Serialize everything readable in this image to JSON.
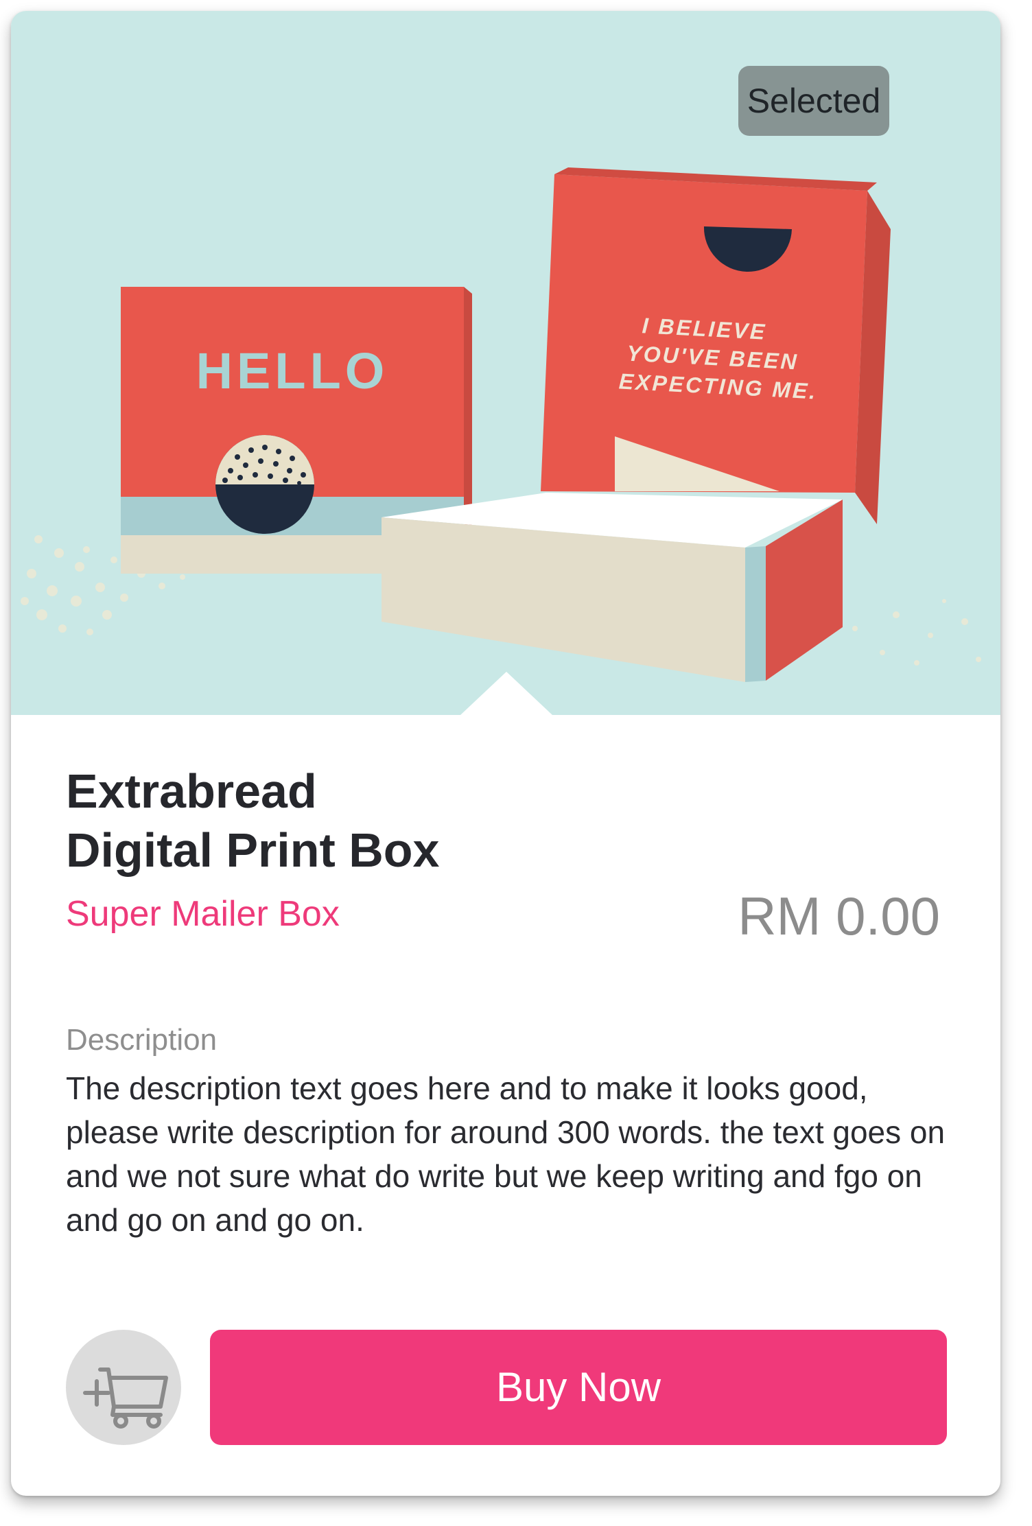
{
  "product": {
    "badge": "Selected",
    "name_line1": "Extrabread",
    "name_line2": "Digital Print Box",
    "category": "Super Mailer Box",
    "price": "RM 0.00"
  },
  "image_text": {
    "closed_box": "HELLO",
    "open_box_line1": "I BELIEVE",
    "open_box_line2": "YOU'VE BEEN",
    "open_box_line3": "EXPECTING ME."
  },
  "description": {
    "label": "Description",
    "text": "The description text goes here and to make it looks good, please write description for around 300 words. the text goes on and we not sure what do write but we keep writing and fgo on and go on and go on."
  },
  "actions": {
    "cart_icon": "add-to-cart-icon",
    "buy_label": "Buy Now"
  },
  "colors": {
    "accent": "#f0397a",
    "hero_bg": "#c9e8e6",
    "box_coral": "#e8574c"
  }
}
